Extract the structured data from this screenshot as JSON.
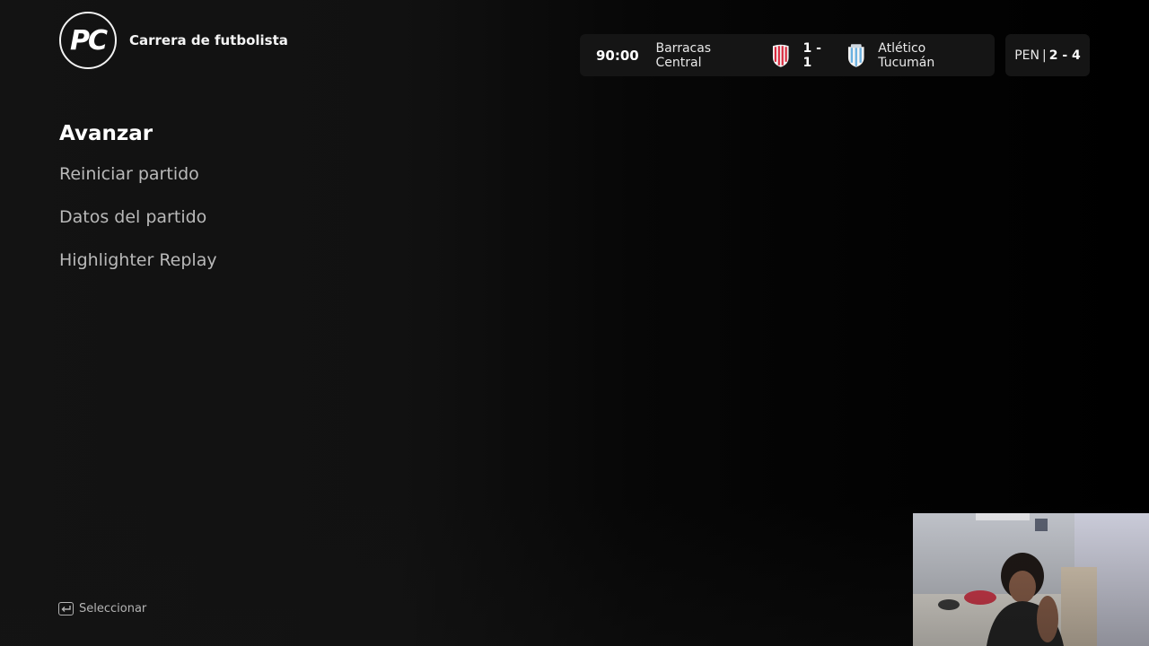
{
  "header": {
    "logo_text": "PC",
    "mode_title": "Carrera de futbolista"
  },
  "scoreboard": {
    "clock": "90:00",
    "home_team": "Barracas Central",
    "score": "1 - 1",
    "away_team": "Atlético Tucumán",
    "home_crest_color": "#d9263b",
    "away_crest_color": "#6ab0e0"
  },
  "penalties": {
    "label": "PEN",
    "score": "2 - 4"
  },
  "menu": {
    "items": [
      {
        "label": "Avanzar",
        "selected": true
      },
      {
        "label": "Reiniciar partido",
        "selected": false
      },
      {
        "label": "Datos del partido",
        "selected": false
      },
      {
        "label": "Highlighter Replay",
        "selected": false
      }
    ]
  },
  "footer": {
    "select_icon": "enter-key-icon",
    "select_label": "Seleccionar"
  },
  "webcam": {
    "icon": "webcam-feed"
  }
}
